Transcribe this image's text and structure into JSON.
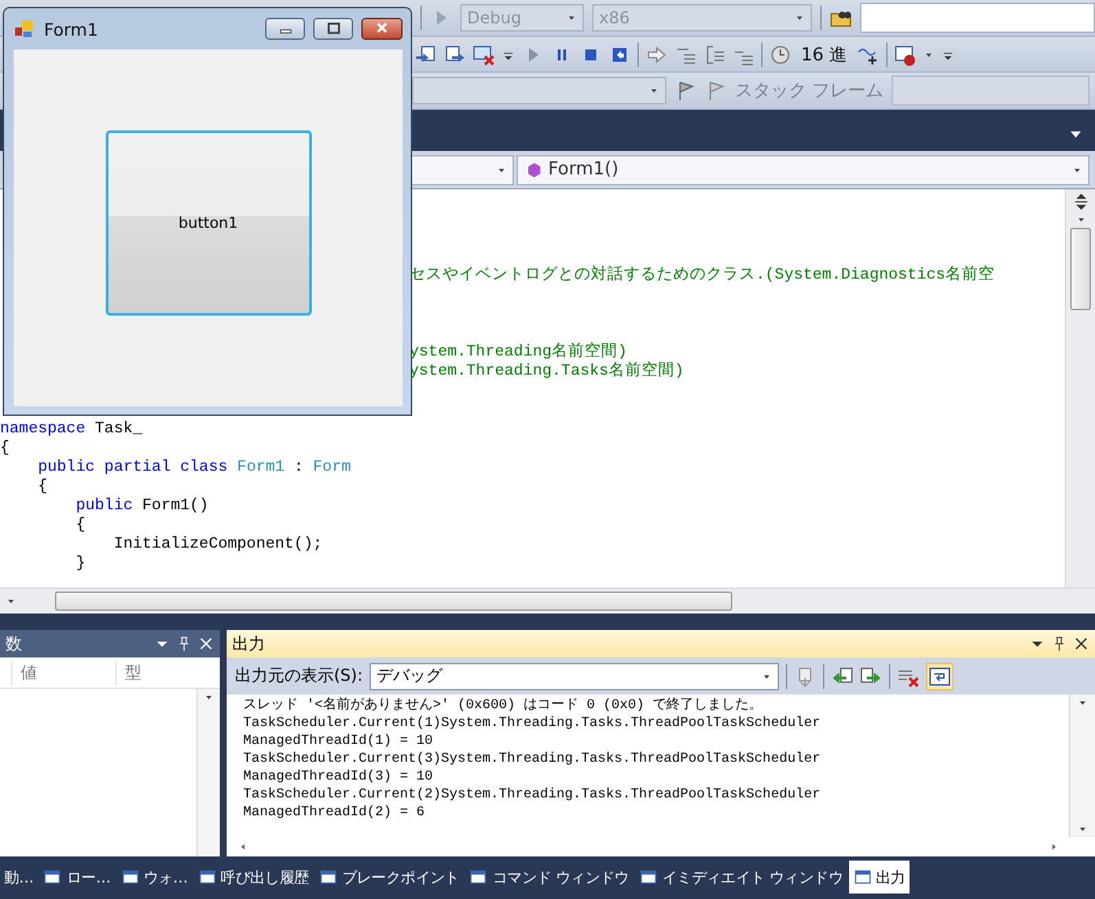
{
  "toolbar": {
    "configuration": "Debug",
    "platform": "x86",
    "hex_button": "16 進",
    "stack_frame_label": "スタック フレーム"
  },
  "editor": {
    "member_dropdown": "Form1()",
    "lines": [
      {
        "kind": "blank"
      },
      {
        "kind": "blank"
      },
      {
        "kind": "blank"
      },
      {
        "kind": "blank"
      },
      {
        "kind": "cut",
        "segments": [
          {
            "kind": "comment",
            "text": "セスやイベントログとの対話するためのクラス.(System.Diagnostics名前空"
          }
        ]
      },
      {
        "kind": "blank"
      },
      {
        "kind": "blank"
      },
      {
        "kind": "blank"
      },
      {
        "kind": "cut",
        "segments": [
          {
            "kind": "comment",
            "text": "ystem.Threading名前空間)"
          }
        ]
      },
      {
        "kind": "cut",
        "segments": [
          {
            "kind": "comment",
            "text": "ystem.Threading.Tasks名前空間)"
          }
        ]
      },
      {
        "kind": "blank"
      },
      {
        "kind": "blank"
      },
      {
        "kind": "code",
        "segments": [
          {
            "kind": "keyword",
            "text": "namespace"
          },
          {
            "kind": "plain",
            "text": " Task_"
          }
        ]
      },
      {
        "kind": "code",
        "segments": [
          {
            "kind": "plain",
            "text": "{"
          }
        ]
      },
      {
        "kind": "code",
        "segments": [
          {
            "kind": "keyword",
            "text": "    public partial class"
          },
          {
            "kind": "type",
            "text": " Form1"
          },
          {
            "kind": "plain",
            "text": " : "
          },
          {
            "kind": "type",
            "text": "Form"
          }
        ]
      },
      {
        "kind": "code",
        "segments": [
          {
            "kind": "plain",
            "text": "    {"
          }
        ]
      },
      {
        "kind": "code",
        "segments": [
          {
            "kind": "keyword",
            "text": "        public"
          },
          {
            "kind": "plain",
            "text": " Form1()"
          }
        ]
      },
      {
        "kind": "code",
        "segments": [
          {
            "kind": "plain",
            "text": "        {"
          }
        ]
      },
      {
        "kind": "code",
        "segments": [
          {
            "kind": "plain",
            "text": "            InitializeComponent();"
          }
        ]
      },
      {
        "kind": "code",
        "segments": [
          {
            "kind": "plain",
            "text": "        }"
          }
        ]
      }
    ]
  },
  "form_window": {
    "title": "Form1",
    "button": "button1"
  },
  "locals_panel": {
    "title": "数",
    "columns": [
      "値",
      "型"
    ]
  },
  "output_panel": {
    "title": "出力",
    "source_label": "出力元の表示(S):",
    "source": "デバッグ",
    "lines": [
      "スレッド '<名前がありません>' (0x600) はコード 0 (0x0) で終了しました。",
      "TaskScheduler.Current(1)System.Threading.Tasks.ThreadPoolTaskScheduler",
      "ManagedThreadId(1) = 10",
      "TaskScheduler.Current(3)System.Threading.Tasks.ThreadPoolTaskScheduler",
      "ManagedThreadId(3) = 10",
      "TaskScheduler.Current(2)System.Threading.Tasks.ThreadPoolTaskScheduler",
      "ManagedThreadId(2) = 6"
    ]
  },
  "bottom_tabs": [
    {
      "label": "動…",
      "selected": false
    },
    {
      "label": "ロー…",
      "selected": false
    },
    {
      "label": "ウォ…",
      "selected": false
    },
    {
      "label": "呼び出し履歴",
      "selected": false
    },
    {
      "label": "ブレークポイント",
      "selected": false
    },
    {
      "label": "コマンド ウィンドウ",
      "selected": false
    },
    {
      "label": "イミディエイト ウィンドウ",
      "selected": false
    },
    {
      "label": "出力",
      "selected": true
    }
  ]
}
